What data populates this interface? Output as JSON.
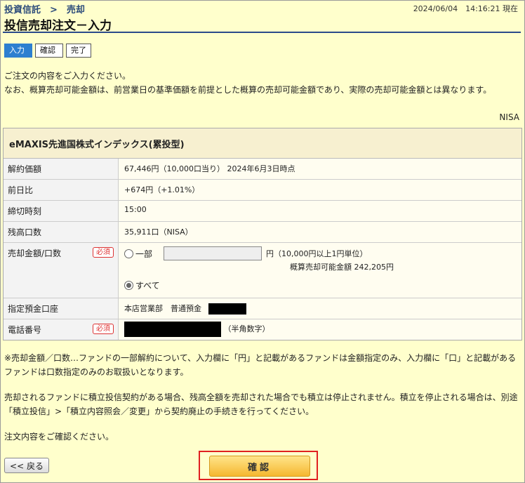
{
  "header": {
    "breadcrumb": "投資信託　>　売却",
    "timestamp": "2024/06/04　14:16:21 現在",
    "title": "投信売却注文－入力"
  },
  "steps": [
    {
      "label": "入力",
      "active": true
    },
    {
      "label": "確認",
      "active": false
    },
    {
      "label": "完了",
      "active": false
    }
  ],
  "intro": {
    "line1": "ご注文の内容をご入力ください。",
    "line2": "なお、概算売却可能金額は、前営業日の基準価額を前提とした概算の売却可能金額であり、実際の売却可能金額とは異なります。"
  },
  "account_type": "NISA",
  "fund": {
    "name": "eMAXIS先進国株式インデックス(累投型)",
    "rows": [
      {
        "label": "解約価額",
        "value": "67,446円（10,000口当り） 2024年6月3日時点"
      },
      {
        "label": "前日比",
        "value": "+674円（+1.01%）"
      },
      {
        "label": "締切時刻",
        "value": "15:00"
      },
      {
        "label": "残高口数",
        "value": "35,911口（NISA）"
      }
    ],
    "sell": {
      "label": "売却金額/口数",
      "required": "必須",
      "partial_label": "一部",
      "unit_note": "円（10,000円以上1円単位）",
      "estimate": "概算売却可能金額 242,205円",
      "all_label": "すべて"
    },
    "account": {
      "label": "指定預金口座",
      "value": "本店営業部　普通預金"
    },
    "phone": {
      "label": "電話番号",
      "required": "必須",
      "note": "（半角数字）"
    }
  },
  "notes": {
    "n1": "※売却金額／口数…ファンドの一部解約について、入力欄に「円」と記載があるファンドは金額指定のみ、入力欄に「口」と記載があるファンドは口数指定のみのお取扱いとなります。",
    "n2": "売却されるファンドに積立投信契約がある場合、残高全額を売却された場合でも積立は停止されません。積立を停止される場合は、別途「積立投信」>「積立内容照会／変更」から契約廃止の手続きを行ってください。",
    "n3": "注文内容をご確認ください。"
  },
  "buttons": {
    "back": "<< 戻る",
    "confirm": "確認"
  }
}
